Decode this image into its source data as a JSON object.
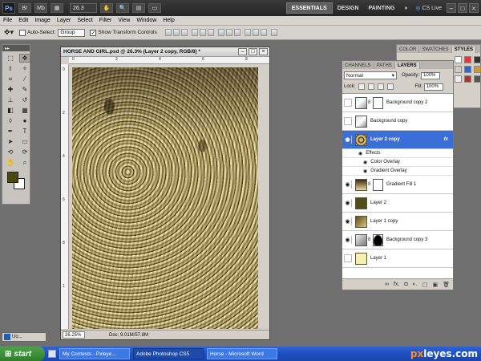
{
  "app": {
    "logo": "Ps",
    "zoom_value": "26.3",
    "workspaces": [
      "ESSENTIALS",
      "DESIGN",
      "PAINTING"
    ],
    "more": "»",
    "cs_live": "CS Live",
    "window_controls": [
      "–",
      "□",
      "×"
    ]
  },
  "menu": [
    "File",
    "Edit",
    "Image",
    "Layer",
    "Select",
    "Filter",
    "View",
    "Window",
    "Help"
  ],
  "options": {
    "auto_select_label": "Auto-Select:",
    "auto_select_value": "Group",
    "show_transform_label": "Show Transform Controls"
  },
  "document": {
    "title": "HORSE AND GIRL.psd @ 26.3% (Layer 2 copy, RGB/8) *",
    "zoom": "26.25%",
    "info": "Doc: 9.01M/57.8M",
    "ruler_top": [
      "0",
      "2",
      "4",
      "6",
      "8"
    ],
    "ruler_left": [
      "0",
      "2",
      "4",
      "6",
      "8",
      "1"
    ]
  },
  "top_panel": {
    "tabs": [
      "COLOR",
      "SWATCHES",
      "STYLES"
    ]
  },
  "layers_panel": {
    "tabs": [
      "CHANNELS",
      "PATHS",
      "LAYERS"
    ],
    "blend_mode": "Normal",
    "opacity_label": "Opacity:",
    "opacity_value": "100%",
    "lock_label": "Lock:",
    "fill_label": "Fill:",
    "fill_value": "100%",
    "layers": [
      {
        "name": "Background copy 2",
        "visible": false,
        "mask": true
      },
      {
        "name": "Background copy",
        "visible": false,
        "mask": false
      },
      {
        "name": "Layer 2 copy",
        "visible": true,
        "mask": false,
        "selected": true,
        "fx": "fx"
      },
      {
        "name": "Gradient Fill 1",
        "visible": true,
        "mask": true
      },
      {
        "name": "Layer 2",
        "visible": true,
        "mask": false
      },
      {
        "name": "Layer 1 copy",
        "visible": true,
        "mask": false
      },
      {
        "name": "Background copy 3",
        "visible": true,
        "mask": true
      },
      {
        "name": "Layer 1",
        "visible": false,
        "mask": false
      }
    ],
    "effects_label": "Effects",
    "effects": [
      "Color Overlay",
      "Gradient Overlay"
    ],
    "footer_icons": [
      "∞",
      "fx.",
      "◘",
      "◐.",
      "▢",
      "▣",
      "🗑"
    ]
  },
  "minimized_doc": "Uo...",
  "taskbar": {
    "start": "start",
    "items": [
      "My Contests - Pxleye...",
      "Adobe Photoshop CS5",
      "Horse - Microsoft Word"
    ],
    "brand_prefix": "px",
    "brand_suffix": "leyes.com"
  }
}
